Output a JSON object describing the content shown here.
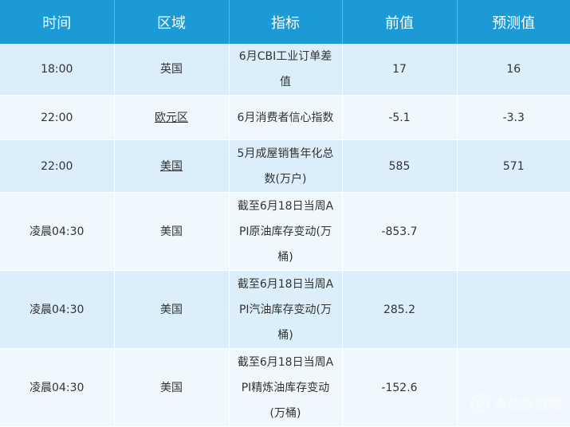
{
  "headers": [
    "时间",
    "区域",
    "指标",
    "前值",
    "预测值"
  ],
  "rows": [
    {
      "time": "18:00",
      "region": "英国",
      "metric": "6月CBI工业订单差值",
      "prev": "17",
      "forecast": "16"
    },
    {
      "time": "22:00",
      "region": "欧元区",
      "metric": "6月消费者信心指数",
      "prev": "-5.1",
      "forecast": "-3.3"
    },
    {
      "time": "22:00",
      "region": "美国",
      "metric": "5月成屋销售年化总数(万户)",
      "prev": "585",
      "forecast": "571"
    },
    {
      "time": "凌晨04:30",
      "region": "美国",
      "metric": "截至6月18日当周API原油库存变动(万桶)",
      "prev": "-853.7",
      "forecast": ""
    },
    {
      "time": "凌晨04:30",
      "region": "美国",
      "metric": "截至6月18日当周API汽油库存变动(万桶)",
      "prev": "285.2",
      "forecast": ""
    },
    {
      "time": "凌晨04:30",
      "region": "美国",
      "metric": "截至6月18日当周API精炼油库存变动(万桶)",
      "prev": "-152.6",
      "forecast": ""
    }
  ],
  "watermark": {
    "text": "本站原创网",
    "icon": "circle-logo-icon"
  }
}
